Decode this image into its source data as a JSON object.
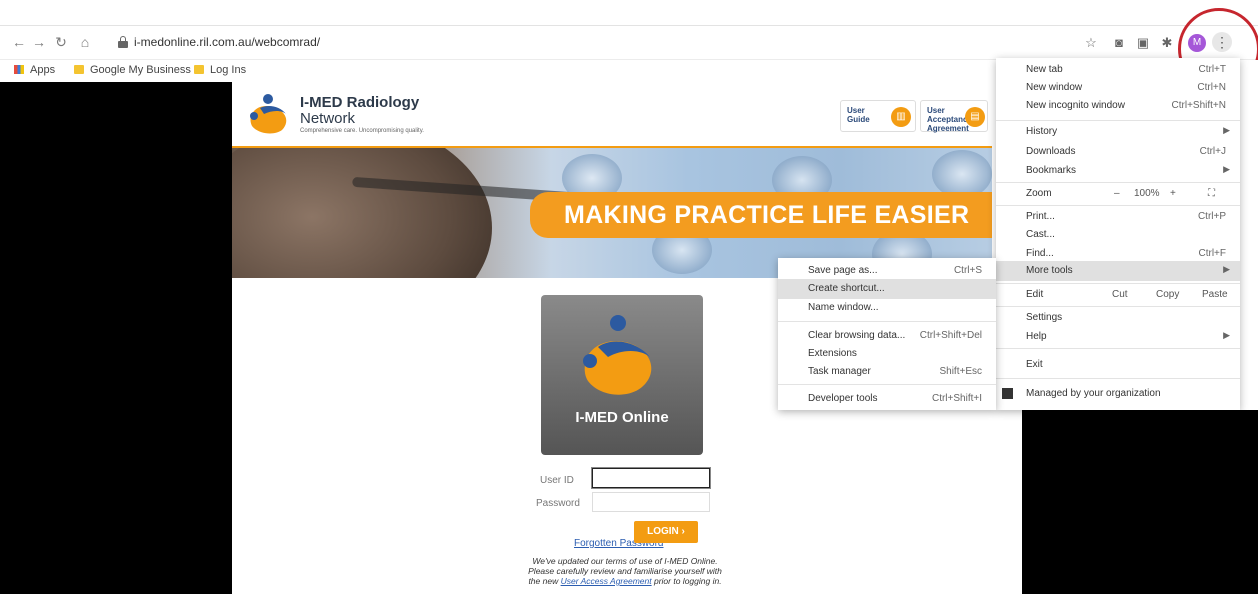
{
  "browser": {
    "url": "i-medonline.ril.com.au/webcomrad/",
    "avatar_letter": "M",
    "bookmarks": [
      "Apps",
      "Google My Business",
      "Log Ins"
    ]
  },
  "site": {
    "brand_title": "I-MED Radiology",
    "brand_sub": "Network",
    "brand_tagline": "Comprehensive care. Uncompromising quality.",
    "user_guide": "User Guide",
    "uaa": "User Acceptance Agreement",
    "banner_text": "MAKING PRACTICE LIFE EASIER",
    "portal_name": "I-MED Online",
    "user_id_label": "User ID",
    "password_label": "Password",
    "forgot_link": "Forgotten Password",
    "login_button": "LOGIN",
    "terms_line1": "We've updated our terms of use of I-MED Online.",
    "terms_line2": "Please carefully review and familiarise yourself with",
    "terms_line3_pre": "the new",
    "terms_link": "User Access Agreement",
    "terms_line3_post": "prior to logging in."
  },
  "menu": {
    "new_tab": "New tab",
    "new_tab_sc": "Ctrl+T",
    "new_window": "New window",
    "new_window_sc": "Ctrl+N",
    "incognito": "New incognito window",
    "incognito_sc": "Ctrl+Shift+N",
    "history": "History",
    "downloads": "Downloads",
    "downloads_sc": "Ctrl+J",
    "bookmarks": "Bookmarks",
    "zoom": "Zoom",
    "zoom_minus": "–",
    "zoom_level": "100%",
    "zoom_plus": "+",
    "print": "Print...",
    "print_sc": "Ctrl+P",
    "cast": "Cast...",
    "find": "Find...",
    "find_sc": "Ctrl+F",
    "more_tools": "More tools",
    "edit": "Edit",
    "cut": "Cut",
    "copy": "Copy",
    "paste": "Paste",
    "settings": "Settings",
    "help": "Help",
    "exit": "Exit",
    "managed": "Managed by your organization"
  },
  "submenu": {
    "save_page": "Save page as...",
    "save_page_sc": "Ctrl+S",
    "create_shortcut": "Create shortcut...",
    "name_window": "Name window...",
    "clear_data": "Clear browsing data...",
    "clear_data_sc": "Ctrl+Shift+Del",
    "extensions": "Extensions",
    "task_manager": "Task manager",
    "task_manager_sc": "Shift+Esc",
    "dev_tools": "Developer tools",
    "dev_tools_sc": "Ctrl+Shift+I"
  }
}
